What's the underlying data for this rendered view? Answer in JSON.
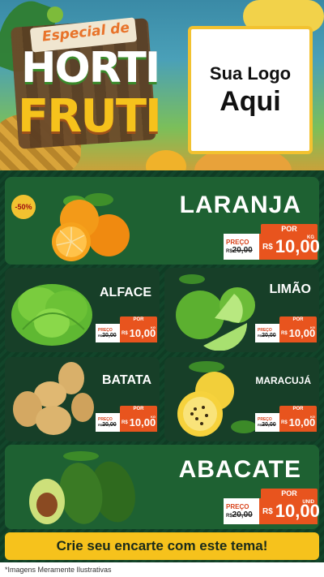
{
  "header": {
    "tag_line": "Especial de",
    "title_top": "HORTI",
    "title_bottom": "FRUTI",
    "logo_line1": "Sua Logo",
    "logo_line2": "Aqui"
  },
  "badge": "-50%",
  "products": [
    {
      "name": "LARANJA",
      "por": "POR",
      "preco": "PREÇO",
      "old_prefix": "R$",
      "old": "20,00",
      "cur": "R$",
      "price": "10,00",
      "unit": "KG"
    },
    {
      "name": "ALFACE",
      "por": "POR",
      "preco": "PREÇO",
      "old_prefix": "R$",
      "old": "20,00",
      "cur": "R$",
      "price": "10,00",
      "unit": "KG"
    },
    {
      "name": "LIMÃO",
      "por": "POR",
      "preco": "PREÇO",
      "old_prefix": "R$",
      "old": "20,00",
      "cur": "R$",
      "price": "10,00",
      "unit": "KG"
    },
    {
      "name": "BATATA",
      "por": "POR",
      "preco": "PREÇO",
      "old_prefix": "R$",
      "old": "20,00",
      "cur": "R$",
      "price": "10,00",
      "unit": "KG"
    },
    {
      "name": "MARACUJÁ",
      "por": "POR",
      "preco": "PREÇO",
      "old_prefix": "R$",
      "old": "20,00",
      "cur": "R$",
      "price": "10,00",
      "unit": "KG"
    },
    {
      "name": "ABACATE",
      "por": "POR",
      "preco": "PREÇO",
      "old_prefix": "R$",
      "old": "20,00",
      "cur": "R$",
      "price": "10,00",
      "unit": "UNID"
    }
  ],
  "cta": "Crie seu encarte com este tema!",
  "footer_note": "*Imagens Meramente Ilustrativas",
  "colors": {
    "accent": "#e8541e",
    "gold": "#f6c21c",
    "panel": "#1c5a30"
  }
}
